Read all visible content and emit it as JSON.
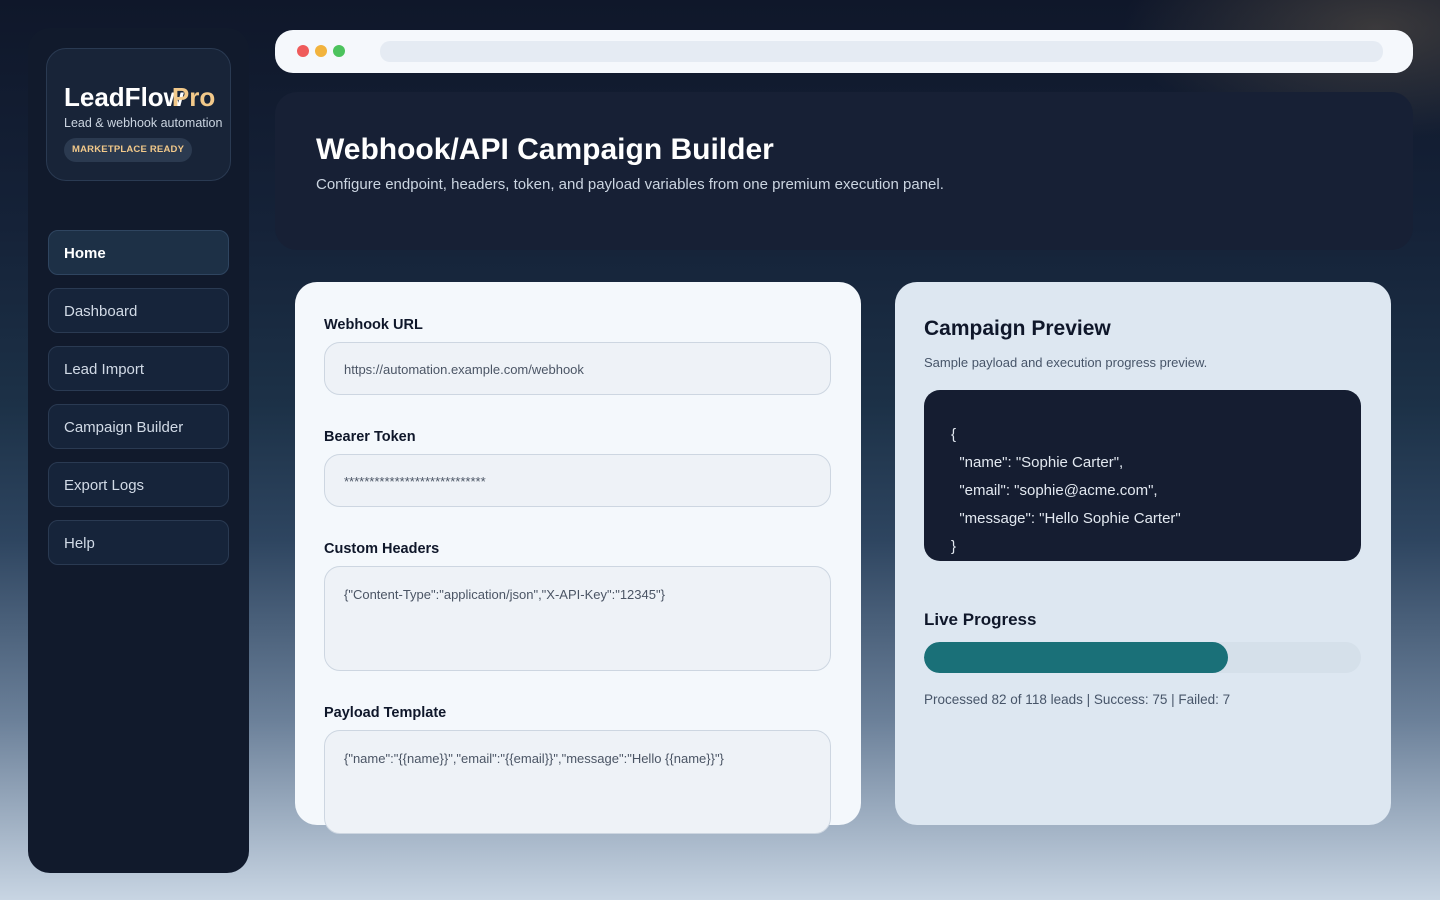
{
  "brand": {
    "name": "LeadFlow",
    "accent": "Pro",
    "tagline": "Lead & webhook automation",
    "badge": "MARKETPLACE READY"
  },
  "nav": {
    "items": [
      {
        "label": "Home",
        "active": true
      },
      {
        "label": "Dashboard",
        "active": false
      },
      {
        "label": "Lead Import",
        "active": false
      },
      {
        "label": "Campaign Builder",
        "active": false
      },
      {
        "label": "Export Logs",
        "active": false
      },
      {
        "label": "Help",
        "active": false
      }
    ]
  },
  "header": {
    "title": "Webhook/API Campaign Builder",
    "subtitle": "Configure endpoint, headers, token, and payload variables from one premium execution panel."
  },
  "form": {
    "webhook_url": {
      "label": "Webhook URL",
      "value": "https://automation.example.com/webhook"
    },
    "bearer_token": {
      "label": "Bearer Token",
      "value": "****************************"
    },
    "custom_headers": {
      "label": "Custom Headers",
      "value": "{\"Content-Type\":\"application/json\",\"X-API-Key\":\"12345\"}"
    },
    "payload_template": {
      "label": "Payload Template",
      "value": "{\"name\":\"{{name}}\",\"email\":\"{{email}}\",\"message\":\"Hello {{name}}\"}"
    }
  },
  "preview": {
    "title": "Campaign Preview",
    "subtitle": "Sample payload and execution progress preview.",
    "code_lines": [
      "{",
      "  \"name\": \"Sophie Carter\",",
      "  \"email\": \"sophie@acme.com\",",
      "  \"message\": \"Hello Sophie Carter\"",
      "}"
    ]
  },
  "progress": {
    "title": "Live Progress",
    "processed": 82,
    "total": 118,
    "status_text": "Processed 82 of 118 leads | Success: 75 | Failed: 7"
  },
  "colors": {
    "accent": "#f2c98a",
    "progress": "#1a7078",
    "sidebar": "#111a2c"
  },
  "window_controls": [
    "close-dot",
    "minimize-dot",
    "maximize-dot"
  ]
}
